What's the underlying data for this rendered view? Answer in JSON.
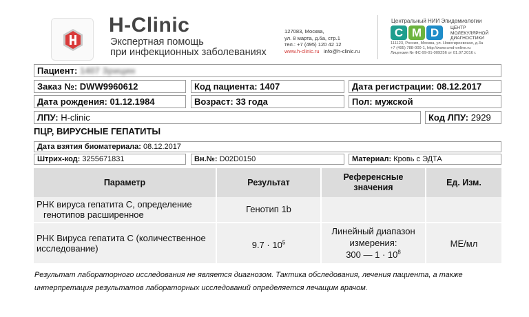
{
  "header": {
    "brand_name": "H-Clinic",
    "tagline_line1": "Экспертная помощь",
    "tagline_line2": "при инфекционных заболеваниях",
    "address_line1": "127083, Москва,",
    "address_line2": "ул. 8 марта, д.6а, стр.1",
    "phone": "тел.: +7 (495) 120 42 12",
    "website": "www.h-clinic.ru",
    "email": "info@h-clinic.ru",
    "lab_institute": "Центральный НИИ Эпидемиологии",
    "lab_logo_letters": [
      "C",
      "M",
      "D"
    ],
    "lab_logo_colors": [
      "#1f9e8e",
      "#6cb43f",
      "#1e8cc8"
    ],
    "lab_sub_line1": "ЦЕНТР",
    "lab_sub_line2": "МОЛЕКУЛЯРНОЙ",
    "lab_sub_line3": "ДИАГНОСТИКИ",
    "lab_addr_line1": "111123, Россия, Москва, ул. Новогиреевская, д.3а",
    "lab_addr_line2": "+7 (495) 788-000-1, http://www.cmd-online.ru",
    "lab_addr_line3": "Лицензия № ФС-99-01-009256 от 01.07.2016 г."
  },
  "patient": {
    "label": "Пациент:",
    "name": "1407 Зрицин"
  },
  "order": {
    "order_label": "Заказ №:",
    "order_value": "DWW9960612",
    "patient_code_label": "Код пациента:",
    "patient_code_value": "1407",
    "registration_label": "Дата регистрации:",
    "registration_value": "08.12.2017",
    "birth_label": "Дата рождения:",
    "birth_value": "01.12.1984",
    "age_label": "Возраст:",
    "age_value": "33 года",
    "sex_label": "Пол:",
    "sex_value": "мужской",
    "lpu_label": "ЛПУ:",
    "lpu_value": "H-clinic",
    "lpu_code_label": "Код ЛПУ:",
    "lpu_code_value": "2929"
  },
  "section": {
    "title": "ПЦР, ВИРУСНЫЕ ГЕПАТИТЫ",
    "sample_date_label": "Дата взятия биоматериала:",
    "sample_date_value": "08.12.2017",
    "barcode_label": "Штрих-код:",
    "barcode_value": "3255671831",
    "internal_label": "Вн.№:",
    "internal_value": "D02D0150",
    "material_label": "Материал:",
    "material_value": "Кровь с ЭДТА"
  },
  "table": {
    "headers": {
      "param": "Параметр",
      "result": "Результат",
      "ref_line1": "Референсные",
      "ref_line2": "значения",
      "unit": "Ед. Изм."
    },
    "rows": [
      {
        "param_line1": "РНК вируса гепатита С, определение",
        "param_line2": "генотипов расширенное",
        "result": "Генотип 1b",
        "ref": "",
        "unit": ""
      },
      {
        "param_line1": "РНК Вируса гепатита С (количественное",
        "param_line2": "исследование)",
        "result_base": "9.7 · 10",
        "result_exp": "5",
        "ref_line1": "Линейный диапазон",
        "ref_line2": "измерения:",
        "ref_line3_base": "300 — 1 · 10",
        "ref_line3_exp": "8",
        "unit": "МЕ/мл"
      }
    ]
  },
  "disclaimer": {
    "line1": "Результат лабораторного исследования не является диагнозом. Тактика обследования, лечения пациента, а также",
    "line2": "интерпретация результатов лабораторных исследований определяется лечащим врачом."
  }
}
